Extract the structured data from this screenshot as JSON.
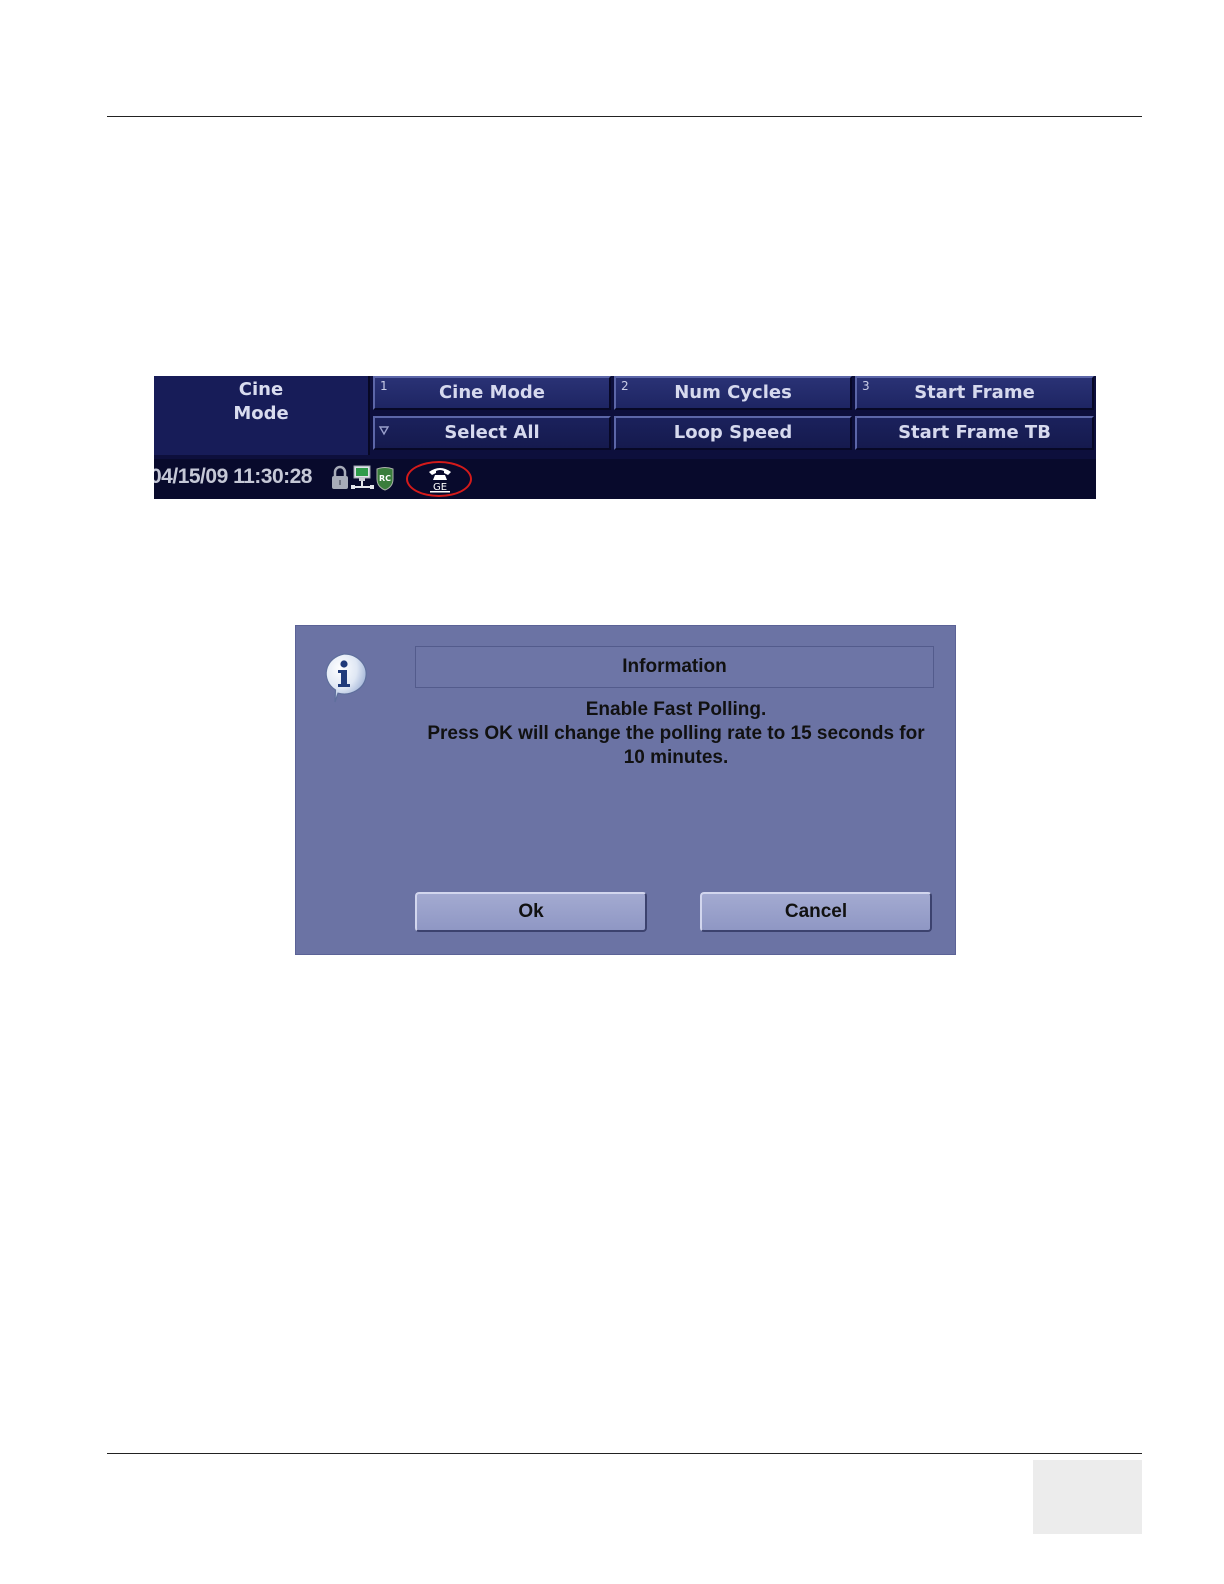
{
  "touch_panel": {
    "title_line1": "Cine",
    "title_line2": "Mode",
    "keys_row1": [
      {
        "number": "1",
        "label": "Cine Mode"
      },
      {
        "number": "2",
        "label": "Num Cycles"
      },
      {
        "number": "3",
        "label": "Start Frame"
      }
    ],
    "keys_row2": [
      {
        "label": "Select All"
      },
      {
        "label": "Loop Speed"
      },
      {
        "label": "Start Frame TB"
      }
    ],
    "status": {
      "datetime": "04/15/09 11:30:28",
      "icons": [
        "lock-icon",
        "network-icon",
        "rc-shield-icon",
        "ge-phone-icon"
      ],
      "rc_badge_text": "RC",
      "phone_text": "GE",
      "highlight_color": "#d41a1a"
    }
  },
  "dialog": {
    "icon": "info-icon",
    "title": "Information",
    "message_lines": [
      "Enable Fast Polling.",
      "Press OK will change the polling rate to 15 seconds for",
      "10 minutes."
    ],
    "ok_label": "Ok",
    "cancel_label": "Cancel"
  }
}
